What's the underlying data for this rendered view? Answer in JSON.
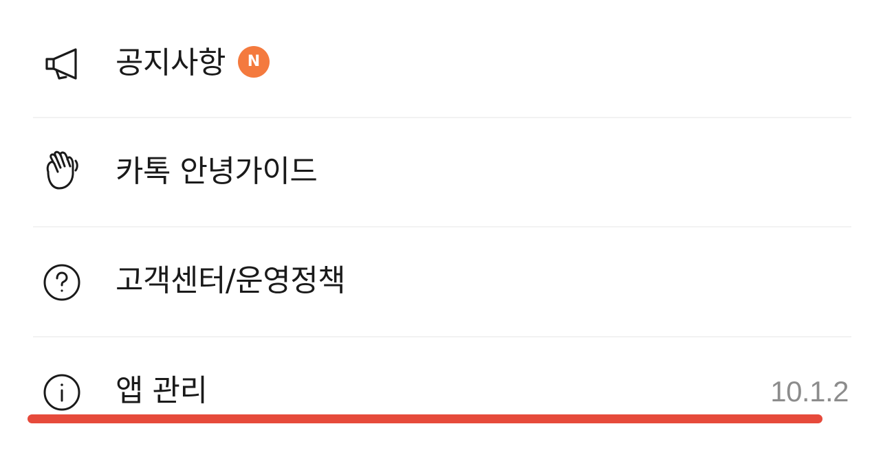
{
  "menu": {
    "notice": {
      "label": "공지사항",
      "badge": "N",
      "icon": "megaphone-icon"
    },
    "guide": {
      "label": "카톡 안녕가이드",
      "icon": "waving-hand-icon"
    },
    "support": {
      "label": "고객센터/운영정책",
      "icon": "question-circle-icon"
    },
    "app": {
      "label": "앱 관리",
      "version": "10.1.2",
      "icon": "info-circle-icon"
    }
  },
  "colors": {
    "badge": "#f47a3e",
    "underline": "#e64a3b",
    "version_text": "#8c8c8c",
    "divider": "#f2f2f2"
  }
}
